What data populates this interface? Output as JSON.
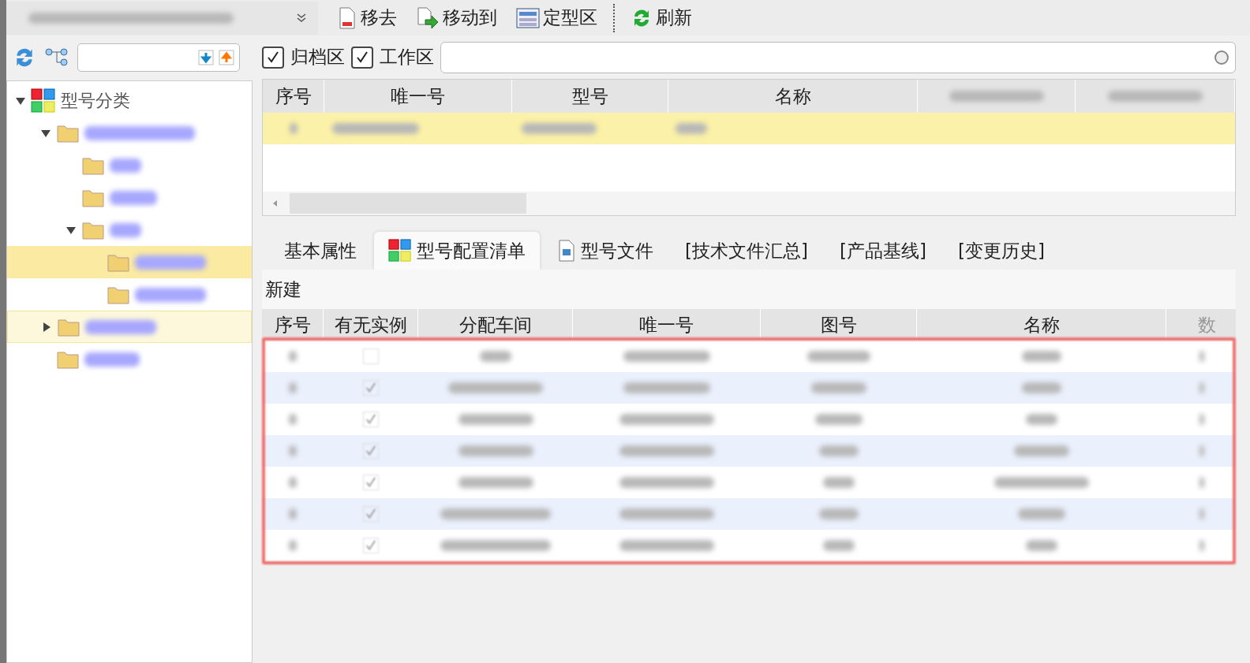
{
  "toolbar": {
    "buttons": [
      {
        "label": "移去",
        "kind": "remove"
      },
      {
        "label": "移动到",
        "kind": "move"
      },
      {
        "label": "定型区",
        "kind": "finalize"
      },
      {
        "label": "刷新",
        "kind": "refresh"
      }
    ]
  },
  "filters": [
    {
      "label": "归档区",
      "checked": true
    },
    {
      "label": "工作区",
      "checked": true
    }
  ],
  "tree": {
    "label": "型号分类",
    "expanded": true,
    "children": [
      {
        "expanded": true,
        "selected": false,
        "hovered": false,
        "children": [
          {
            "selected": false,
            "hovered": false
          },
          {
            "selected": false,
            "hovered": false
          },
          {
            "expanded": true,
            "selected": false,
            "hovered": false,
            "children": [
              {
                "selected": true,
                "hovered": false
              },
              {
                "selected": false,
                "hovered": false
              }
            ]
          }
        ]
      },
      {
        "expanded": false,
        "selected": false,
        "hovered": true
      },
      {
        "selected": false,
        "hovered": false
      }
    ]
  },
  "upper_table": {
    "columns": [
      "序号",
      "唯一号",
      "型号",
      "名称"
    ],
    "rows": [
      {
        "selected": true
      }
    ]
  },
  "tabs": [
    {
      "label": "基本属性",
      "selected": false
    },
    {
      "label": "型号配置清单",
      "selected": true,
      "kind": "grid"
    },
    {
      "label": "型号文件",
      "selected": false,
      "kind": "doc"
    },
    {
      "label": "[技术文件汇总]",
      "selected": false
    },
    {
      "label": "[产品基线]",
      "selected": false
    },
    {
      "label": "[变更历史]",
      "selected": false
    }
  ],
  "new_button": "新建",
  "lower_table": {
    "columns": [
      "序号",
      "有无实例",
      "分配车间",
      "唯一号",
      "图号",
      "名称",
      "数"
    ],
    "rows": [
      {
        "has_instance": false
      },
      {
        "has_instance": true
      },
      {
        "has_instance": true
      },
      {
        "has_instance": true
      },
      {
        "has_instance": true
      },
      {
        "has_instance": true
      },
      {
        "has_instance": true
      }
    ]
  }
}
